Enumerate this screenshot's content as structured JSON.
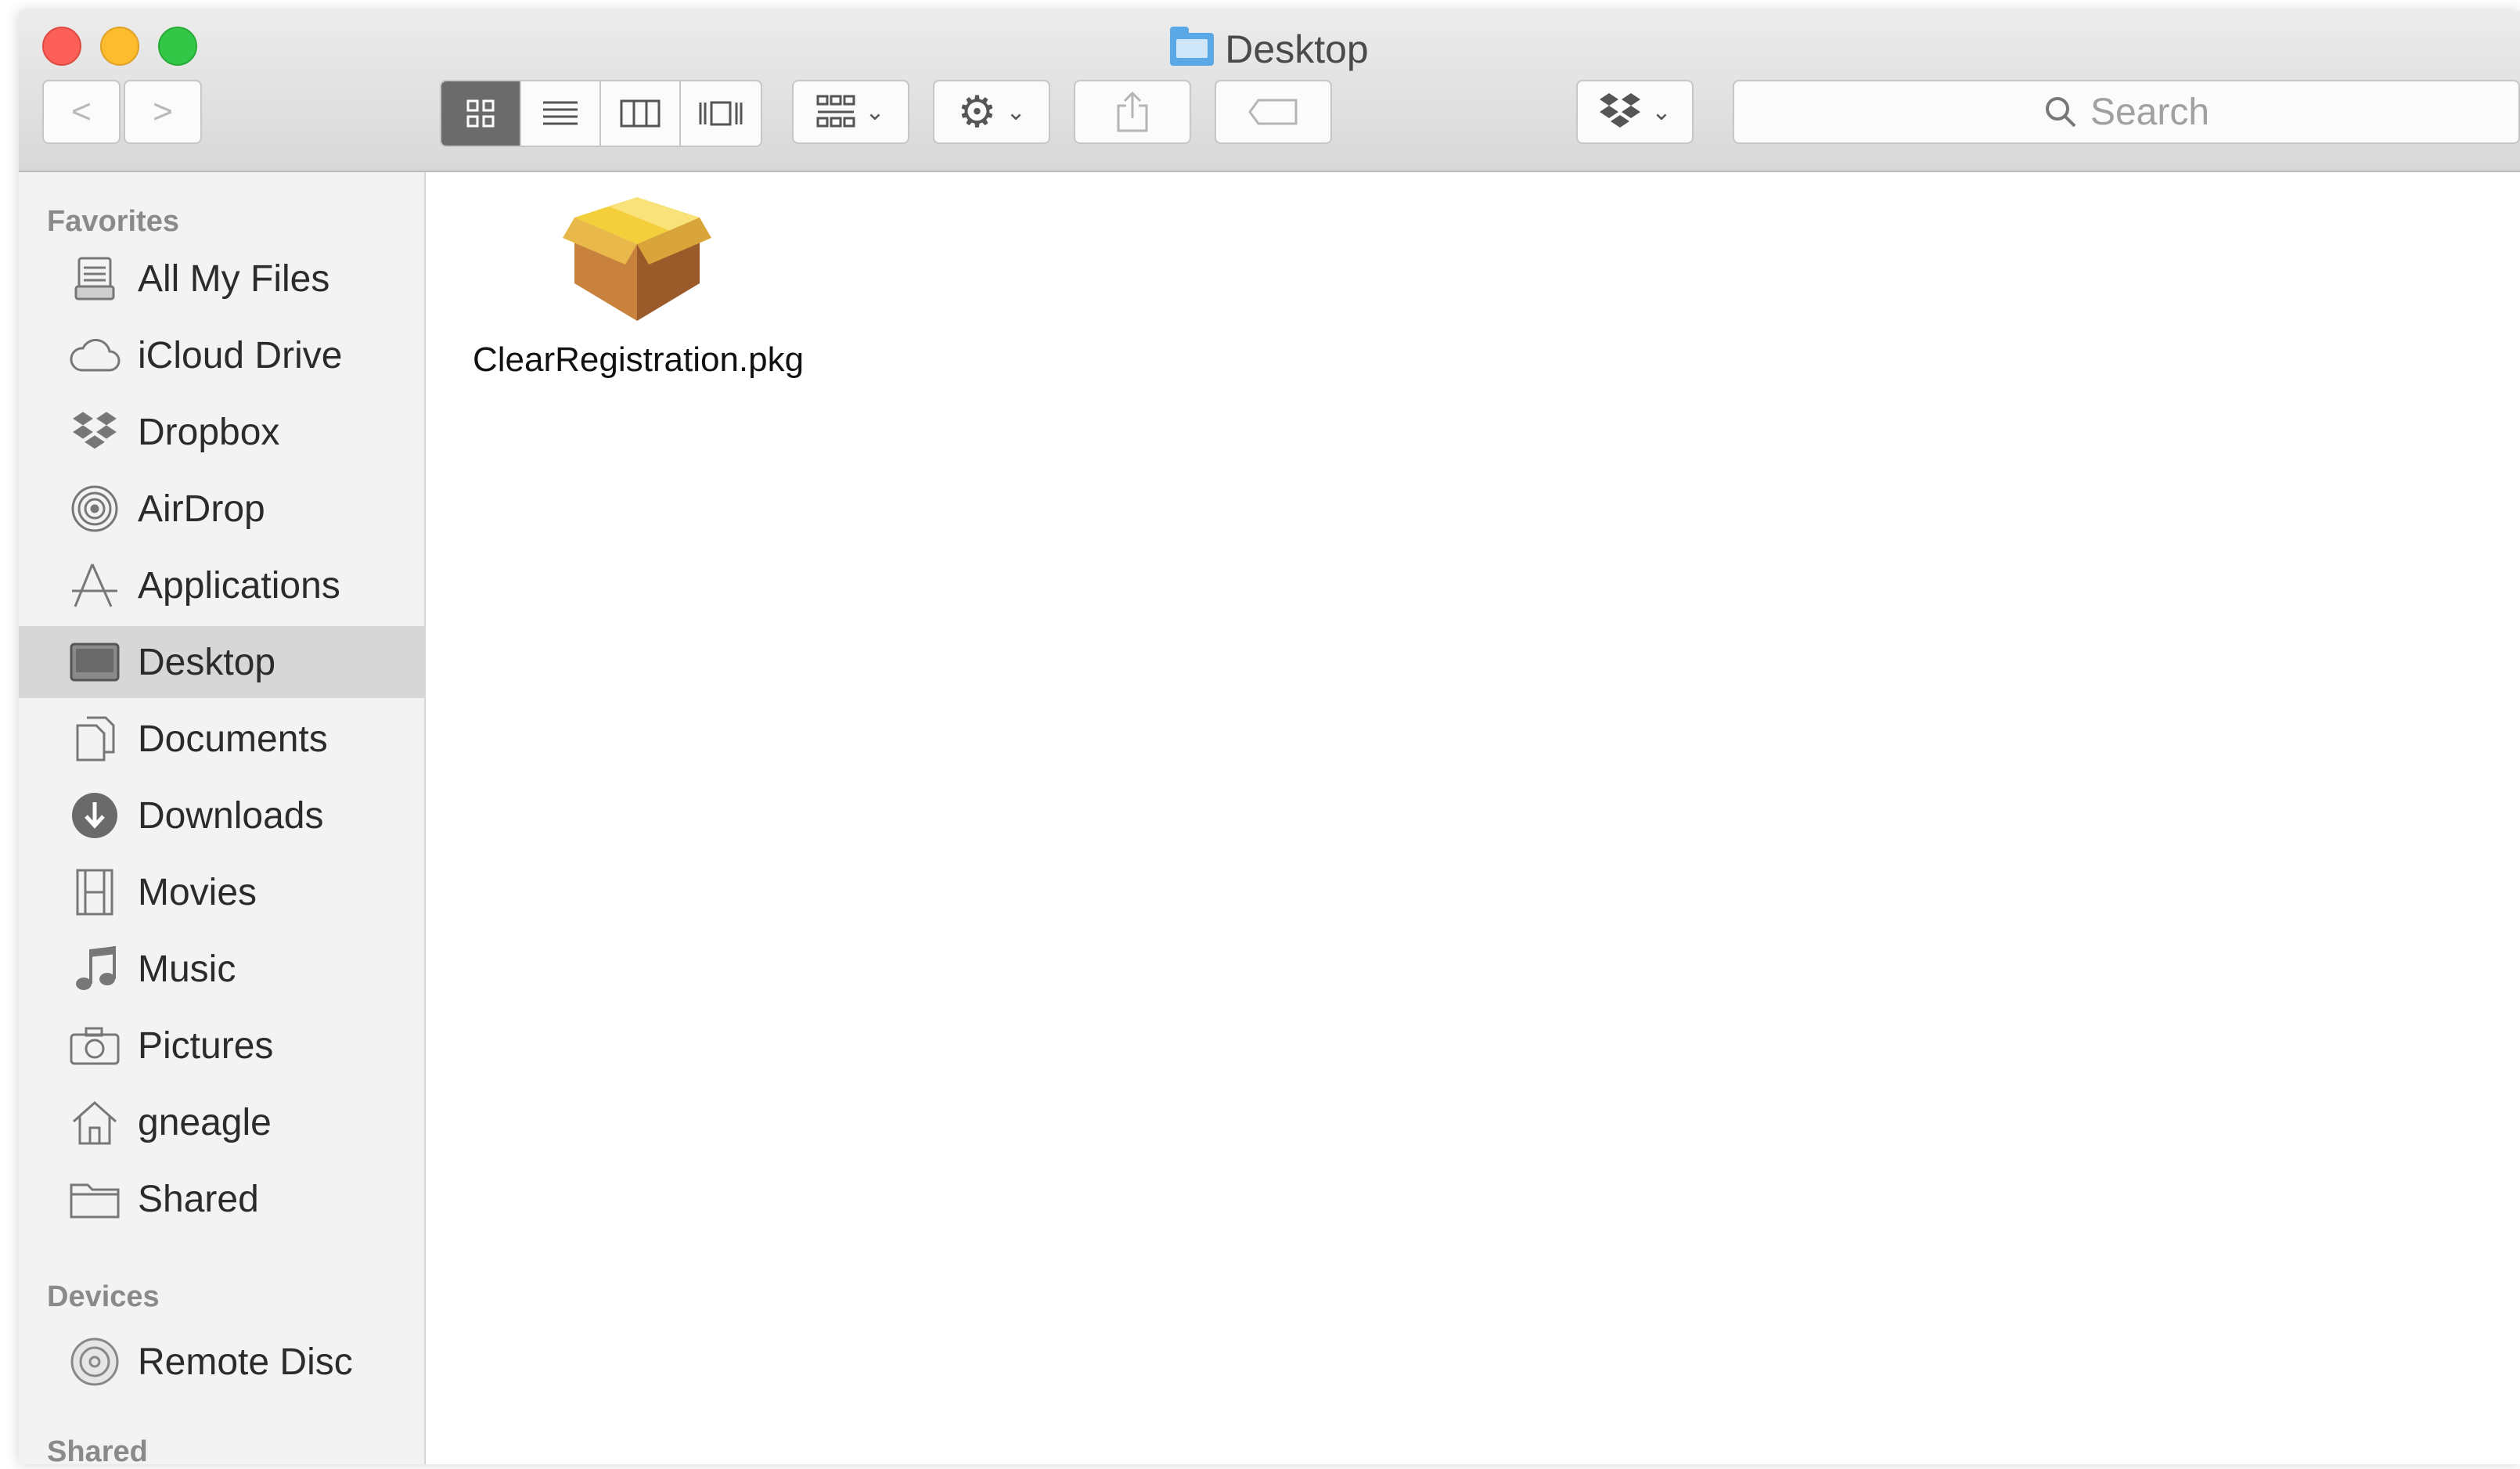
{
  "window": {
    "title": "Desktop"
  },
  "toolbar": {
    "back": "<",
    "forward": ">",
    "search_placeholder": "Search"
  },
  "sidebar": {
    "favorites_header": "Favorites",
    "favorites": [
      {
        "label": "All My Files",
        "icon": "all-files-icon"
      },
      {
        "label": "iCloud Drive",
        "icon": "cloud-icon"
      },
      {
        "label": "Dropbox",
        "icon": "dropbox-icon"
      },
      {
        "label": "AirDrop",
        "icon": "airdrop-icon"
      },
      {
        "label": "Applications",
        "icon": "applications-icon"
      },
      {
        "label": "Desktop",
        "icon": "desktop-icon",
        "selected": true
      },
      {
        "label": "Documents",
        "icon": "documents-icon"
      },
      {
        "label": "Downloads",
        "icon": "download-icon"
      },
      {
        "label": "Movies",
        "icon": "film-icon"
      },
      {
        "label": "Music",
        "icon": "music-note-icon"
      },
      {
        "label": "Pictures",
        "icon": "camera-icon"
      },
      {
        "label": "gneagle",
        "icon": "home-icon"
      },
      {
        "label": "Shared",
        "icon": "folder-icon"
      }
    ],
    "devices_header": "Devices",
    "devices": [
      {
        "label": "Remote Disc",
        "icon": "disc-icon"
      }
    ],
    "shared_header": "Shared"
  },
  "files": [
    {
      "name": "ClearRegistration.pkg",
      "icon": "package-icon"
    }
  ]
}
